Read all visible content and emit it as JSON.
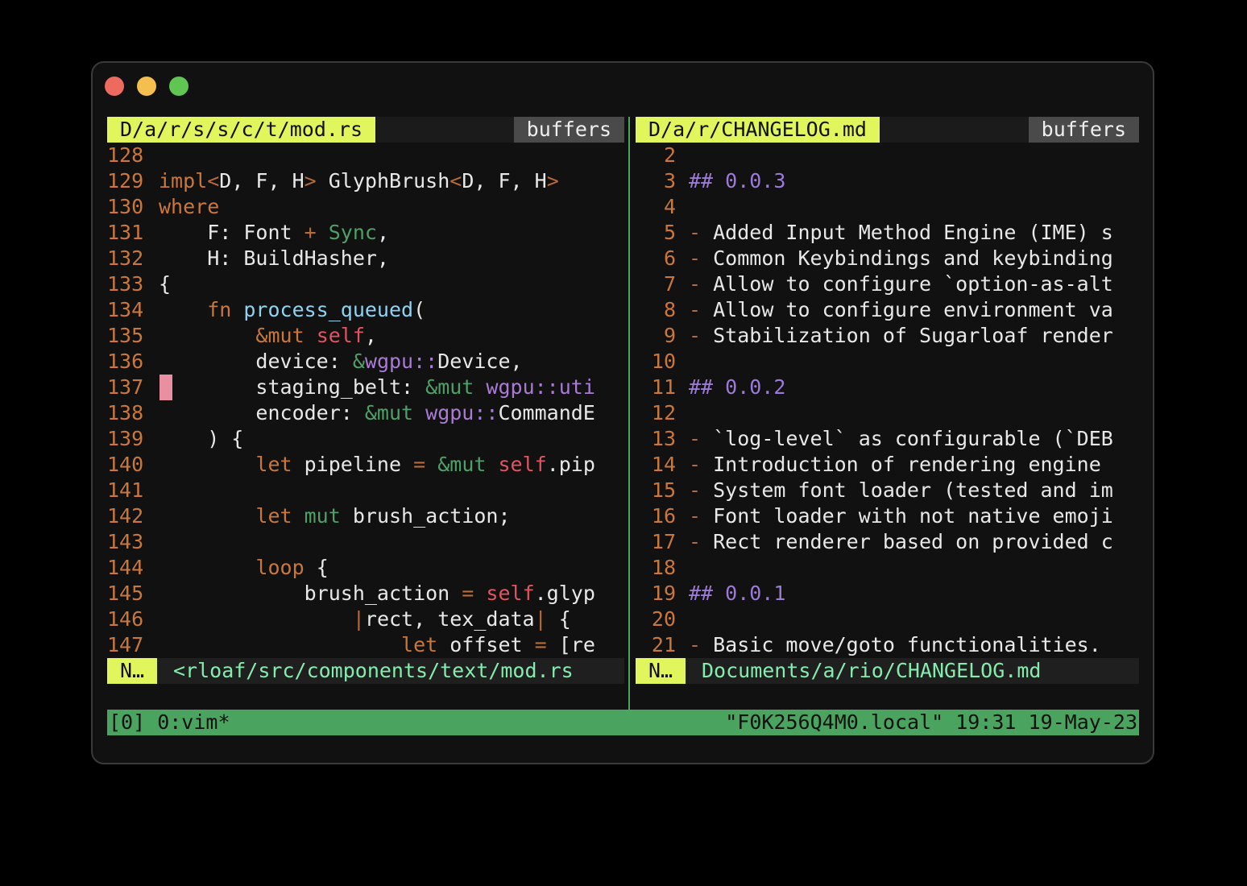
{
  "left": {
    "tab": "D/a/r/s/s/c/t/mod.rs",
    "buffers_label": "buffers",
    "lines": [
      "128",
      "129",
      "130",
      "131",
      "132",
      "133",
      "134",
      "135",
      "136",
      "137",
      "138",
      "139",
      "140",
      "141",
      "142",
      "143",
      "144",
      "145",
      "146",
      "147"
    ],
    "code": {
      "l129": {
        "a": "impl",
        "b": "<",
        "c": "D, F, H",
        "d": ">",
        "e": " GlyphBrush",
        "f": "<",
        "g": "D, F, H",
        "h": ">"
      },
      "l130": "where",
      "l131": {
        "a": "    F: Font ",
        "b": "+",
        "c": " Sync",
        "d": ","
      },
      "l132": "    H: BuildHasher,",
      "l133": "{",
      "l134": {
        "a": "    fn ",
        "b": "process_queued",
        "c": "("
      },
      "l135": {
        "a": "        ",
        "b": "&mut",
        "c": " self",
        "d": ","
      },
      "l136": {
        "a": "        device: ",
        "b": "&",
        "c": "wgpu::",
        "d": "Device,"
      },
      "l137": {
        "a": "        staging_belt: ",
        "b": "&mut",
        "c": " wgpu::uti"
      },
      "l138": {
        "a": "        encoder: ",
        "b": "&mut",
        "c": " wgpu::",
        "d": "CommandE"
      },
      "l139": "    ) {",
      "l140": {
        "a": "        ",
        "b": "let",
        "c": " pipeline ",
        "d": "=",
        "e": " ",
        "f": "&mut",
        "g": " self",
        "h": ".pip"
      },
      "l142": {
        "a": "        ",
        "b": "let",
        "c": " mut",
        "d": " brush_action;"
      },
      "l144": {
        "a": "        ",
        "b": "loop",
        "c": " {"
      },
      "l145": {
        "a": "            brush_action ",
        "b": "=",
        "c": " self",
        "d": ".glyp"
      },
      "l146": {
        "a": "                ",
        "b": "|",
        "c": "rect, tex_data",
        "d": "|",
        "e": " {"
      },
      "l147": {
        "a": "                    ",
        "b": "let",
        "c": " offset ",
        "d": "=",
        "e": " [re"
      }
    },
    "mode": "N…",
    "filename": "<rloaf/src/components/text/mod.rs"
  },
  "right": {
    "tab": "D/a/r/CHANGELOG.md",
    "buffers_label": "buffers",
    "rows": [
      {
        "n": "2",
        "dash": "",
        "text": "",
        "heading": ""
      },
      {
        "n": "3",
        "dash": "",
        "text": "",
        "heading": "## 0.0.3"
      },
      {
        "n": "4",
        "dash": "",
        "text": "",
        "heading": ""
      },
      {
        "n": "5",
        "dash": "-",
        "text": " Added Input Method Engine (IME) s",
        "heading": ""
      },
      {
        "n": "6",
        "dash": "-",
        "text": " Common Keybindings and keybinding",
        "heading": ""
      },
      {
        "n": "7",
        "dash": "-",
        "text": " Allow to configure `option-as-alt",
        "heading": ""
      },
      {
        "n": "8",
        "dash": "-",
        "text": " Allow to configure environment va",
        "heading": ""
      },
      {
        "n": "9",
        "dash": "-",
        "text": " Stabilization of Sugarloaf render",
        "heading": ""
      },
      {
        "n": "10",
        "dash": "",
        "text": "",
        "heading": ""
      },
      {
        "n": "11",
        "dash": "",
        "text": "",
        "heading": "## 0.0.2"
      },
      {
        "n": "12",
        "dash": "",
        "text": "",
        "heading": ""
      },
      {
        "n": "13",
        "dash": "-",
        "text": " `log-level` as configurable (`DEB",
        "heading": ""
      },
      {
        "n": "14",
        "dash": "-",
        "text": " Introduction of rendering engine ",
        "heading": ""
      },
      {
        "n": "15",
        "dash": "-",
        "text": " System font loader (tested and im",
        "heading": ""
      },
      {
        "n": "16",
        "dash": "-",
        "text": " Font loader with not native emoji",
        "heading": ""
      },
      {
        "n": "17",
        "dash": "-",
        "text": " Rect renderer based on provided c",
        "heading": ""
      },
      {
        "n": "18",
        "dash": "",
        "text": "",
        "heading": ""
      },
      {
        "n": "19",
        "dash": "",
        "text": "",
        "heading": "## 0.0.1"
      },
      {
        "n": "20",
        "dash": "",
        "text": "",
        "heading": ""
      },
      {
        "n": "21",
        "dash": "-",
        "text": " Basic move/goto functionalities.",
        "heading": ""
      }
    ],
    "mode": "N…",
    "filename": "Documents/a/rio/CHANGELOG.md"
  },
  "tmux": {
    "left": "[0] 0:vim*",
    "right": "\"F0K256Q4M0.local\" 19:31 19-May-23"
  },
  "colors": {
    "accent_yellow": "#e1f55d",
    "status_green": "#4aa35e",
    "line_number": "#c9783a",
    "cursor": "#e88fa2"
  }
}
